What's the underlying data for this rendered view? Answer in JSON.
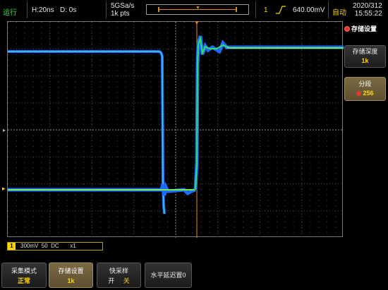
{
  "topbar": {
    "run_state": "运行",
    "horizontal_scale": "H:20ns",
    "delay": "D: 0s",
    "sample_rate": "5GSa/s",
    "memory_points": "1k pts",
    "trigger_channel": "1",
    "trigger_level": "640.00mV",
    "trigger_mode": "自动",
    "date": "2020/312",
    "time": "15:55:22"
  },
  "menu": {
    "title": "存储设置",
    "depth_label": "存储深度",
    "depth_value": "1k",
    "segment_label": "分段",
    "segment_value": "256"
  },
  "channel": {
    "number": "1",
    "info": "300mV  50  DC       x1"
  },
  "softkeys": {
    "acq_mode_label": "采集模式",
    "acq_mode_value": "正常",
    "storage_label": "存储设置",
    "storage_value": "1k",
    "fast_acq_label": "快采样",
    "fast_acq_on": "开",
    "fast_acq_off": "关",
    "hdelay_label": "水平延迟置0"
  },
  "colors": {
    "run_green": "#3fd84a",
    "channel1_yellow": "#ffd500",
    "trigger_orange": "#f08a24",
    "trace_blue": "#2a8cff",
    "menu_gold": "#7a6a44"
  }
}
